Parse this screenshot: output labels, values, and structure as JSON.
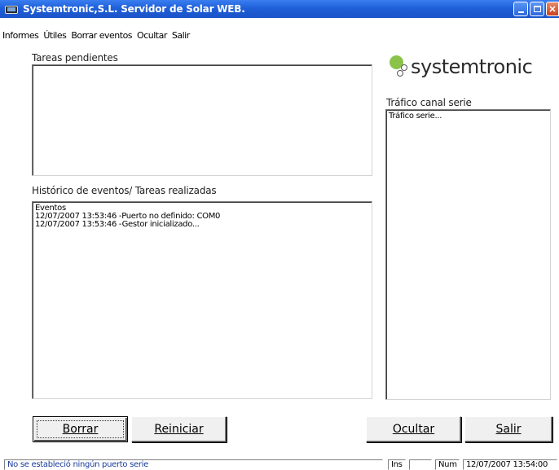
{
  "window": {
    "title": "Systemtronic,S.L. Servidor de Solar WEB.",
    "icon": "app-window-icon",
    "controls": [
      "minimize-icon",
      "maximize-icon",
      "close-icon"
    ],
    "title_bar_color": "#1f5fd8"
  },
  "menu": {
    "items": [
      "Informes",
      "Útiles",
      "Borrar eventos",
      "Ocultar",
      "Salir"
    ]
  },
  "pending": {
    "label": "Tareas pendientes"
  },
  "history": {
    "label": "Histórico de eventos/ Tareas realizadas",
    "lines": [
      "Eventos",
      "12/07/2007 13:53:46 -Puerto no definido: COM0",
      "12/07/2007 13:53:46 -Gestor inicializado..."
    ]
  },
  "logo": {
    "text": "systemtronic",
    "accent_color": "#8bc34a"
  },
  "serial": {
    "label": "Tráfico canal serie",
    "content": "Tráfico serie..."
  },
  "buttons": {
    "borrar": "Borrar",
    "reiniciar": "Reiniciar",
    "ocultar": "Ocultar",
    "salir": "Salir"
  },
  "status": {
    "message": "No se estableció ningún puerto serie",
    "ins": "Ins",
    "blank": "",
    "num": "Num",
    "datetime": "12/07/2007 13:54:00"
  }
}
